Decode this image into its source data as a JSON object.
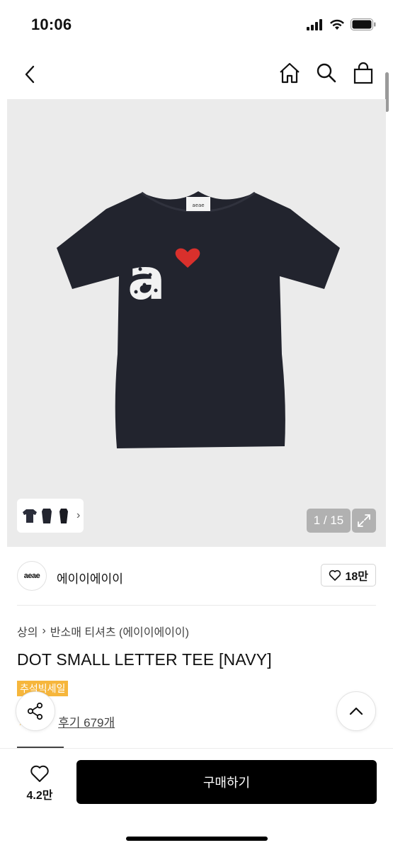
{
  "status_bar": {
    "time": "10:06"
  },
  "nav": {
    "back_icon": "chevron-left-icon",
    "home_icon": "home-icon",
    "search_icon": "search-icon",
    "bag_icon": "shopping-bag-icon"
  },
  "gallery": {
    "page_counter": "1 / 15",
    "thumbnail_chevron": "›"
  },
  "brand": {
    "logo_text": "aeae",
    "name": "에이이에이이",
    "like_count": "18만"
  },
  "breadcrumb": {
    "category": "상의",
    "separator": "›",
    "subcategory": "반소매 티셔츠 (에이이에이이)"
  },
  "product": {
    "title": "DOT SMALL LETTER TEE [NAVY]",
    "sale_badge": "추석빅세일",
    "review_link": "후기 679개"
  },
  "bottom_bar": {
    "wish_count": "4.2만",
    "buy_label": "구매하기"
  },
  "colors": {
    "accent": "#f6b63c",
    "buy_button": "#000000",
    "heart": "#d9302c",
    "shirt": "#22242e"
  }
}
